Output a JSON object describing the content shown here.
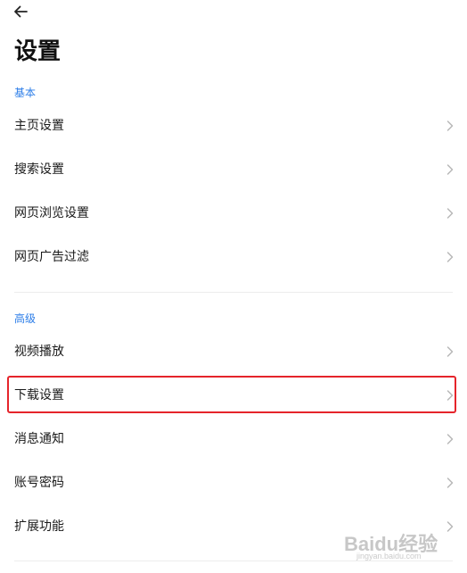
{
  "header": {
    "back_icon": "arrow-left-icon",
    "title": "设置"
  },
  "sections": [
    {
      "header": "基本",
      "items": [
        {
          "label": "主页设置",
          "icon": "chevron-right-icon"
        },
        {
          "label": "搜索设置",
          "icon": "chevron-right-icon"
        },
        {
          "label": "网页浏览设置",
          "icon": "chevron-right-icon"
        },
        {
          "label": "网页广告过滤",
          "icon": "chevron-right-icon"
        }
      ]
    },
    {
      "header": "高级",
      "items": [
        {
          "label": "视频播放",
          "icon": "chevron-right-icon"
        },
        {
          "label": "下载设置",
          "icon": "chevron-right-icon",
          "highlighted": true
        },
        {
          "label": "消息通知",
          "icon": "chevron-right-icon"
        },
        {
          "label": "账号密码",
          "icon": "chevron-right-icon"
        },
        {
          "label": "扩展功能",
          "icon": "chevron-right-icon"
        }
      ]
    }
  ],
  "colors": {
    "section_header": "#2d7ee8",
    "highlight_border": "#e5242b",
    "divider": "#ededed"
  },
  "watermark": {
    "text": "Baidu经验",
    "sub": "jingyan.baidu.com"
  }
}
